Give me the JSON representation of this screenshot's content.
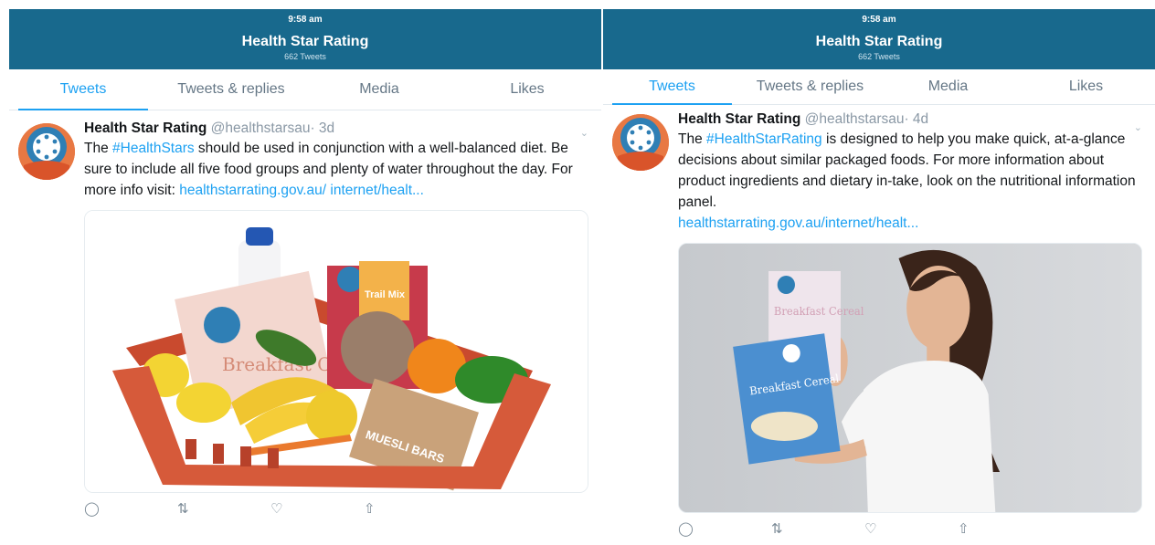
{
  "panels": [
    {
      "status_time": "9:58 am",
      "profile_title": "Health Star Rating",
      "tweet_count": "662 Tweets",
      "tabs": [
        "Tweets",
        "Tweets & replies",
        "Media",
        "Likes"
      ],
      "tweet": {
        "name": "Health Star Rating",
        "handle": "@healthstarsau",
        "time": "· 3d",
        "text_before": "The ",
        "hashtag": "#HealthStars",
        "text_after": " should be used in conjunction with a well-balanced diet. Be sure to include all five food groups and plenty of water throughout the day. For more info visit: ",
        "link": "healthstarrating.gov.au/ internet/healt...",
        "box_label_1": "Breakfast Cereal",
        "box_label_2": "Trail Mix",
        "box_label_3": "MUESLI BARS"
      }
    },
    {
      "status_time": "9:58 am",
      "profile_title": "Health Star Rating",
      "tweet_count": "662 Tweets",
      "tabs": [
        "Tweets",
        "Tweets & replies",
        "Media",
        "Likes"
      ],
      "tweet": {
        "name": "Health Star Rating",
        "handle": "@healthstarsau",
        "time": "· 4d",
        "text_before": "The ",
        "hashtag": "#HealthStarRating",
        "text_after": " is designed to help you make quick, at-a-glance decisions about similar packaged foods. For more information about product ingredients and dietary in-take, look on the nutritional information panel.",
        "link": "healthstarrating.gov.au/internet/healt...",
        "box_label_1": "Breakfast Cereal",
        "box_label_2": "Breakfast Cereal"
      }
    }
  ],
  "icons": {
    "reply": "reply-icon",
    "retweet": "retweet-icon",
    "like": "heart-icon",
    "share": "share-icon",
    "caret": "chevron-down-icon"
  },
  "colors": {
    "header_bg": "#18698d",
    "accent": "#1da1f2",
    "avatar_bg": "#e87843",
    "basket": "#d65a3a"
  }
}
